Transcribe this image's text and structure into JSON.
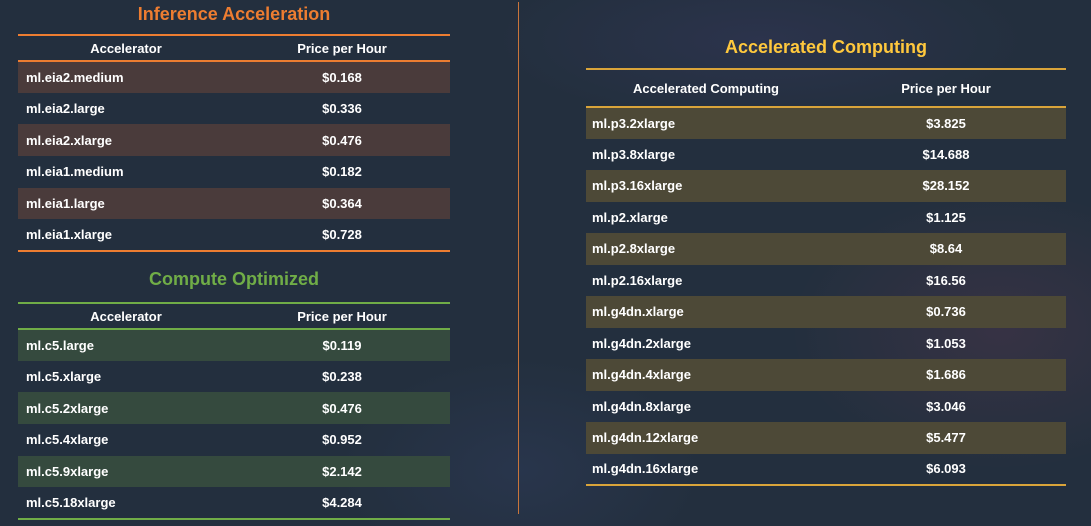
{
  "colors": {
    "background": "#232f3e",
    "inference_accent": "#ed7d31",
    "compute_accent": "#70ad47",
    "accelerated_accent": "#ffc83d"
  },
  "inference": {
    "title": "Inference Acceleration",
    "headers": [
      "Accelerator",
      "Price per Hour"
    ],
    "rows": [
      {
        "name": "ml.eia2.medium",
        "price": "$0.168"
      },
      {
        "name": "ml.eia2.large",
        "price": "$0.336"
      },
      {
        "name": "ml.eia2.xlarge",
        "price": "$0.476"
      },
      {
        "name": "ml.eia1.medium",
        "price": "$0.182"
      },
      {
        "name": "ml.eia1.large",
        "price": "$0.364"
      },
      {
        "name": "ml.eia1.xlarge",
        "price": "$0.728"
      }
    ]
  },
  "compute": {
    "title": "Compute Optimized",
    "headers": [
      "Accelerator",
      "Price per Hour"
    ],
    "rows": [
      {
        "name": "ml.c5.large",
        "price": "$0.119"
      },
      {
        "name": "ml.c5.xlarge",
        "price": "$0.238"
      },
      {
        "name": "ml.c5.2xlarge",
        "price": "$0.476"
      },
      {
        "name": "ml.c5.4xlarge",
        "price": "$0.952"
      },
      {
        "name": "ml.c5.9xlarge",
        "price": "$2.142"
      },
      {
        "name": "ml.c5.18xlarge",
        "price": "$4.284"
      }
    ]
  },
  "accelerated": {
    "title": "Accelerated Computing",
    "headers": [
      "Accelerated Computing",
      "Price per Hour"
    ],
    "rows": [
      {
        "name": "ml.p3.2xlarge",
        "price": "$3.825"
      },
      {
        "name": "ml.p3.8xlarge",
        "price": "$14.688"
      },
      {
        "name": "ml.p3.16xlarge",
        "price": "$28.152"
      },
      {
        "name": "ml.p2.xlarge",
        "price": "$1.125"
      },
      {
        "name": "ml.p2.8xlarge",
        "price": "$8.64"
      },
      {
        "name": "ml.p2.16xlarge",
        "price": "$16.56"
      },
      {
        "name": "ml.g4dn.xlarge",
        "price": "$0.736"
      },
      {
        "name": "ml.g4dn.2xlarge",
        "price": "$1.053"
      },
      {
        "name": "ml.g4dn.4xlarge",
        "price": "$1.686"
      },
      {
        "name": "ml.g4dn.8xlarge",
        "price": "$3.046"
      },
      {
        "name": "ml.g4dn.12xlarge",
        "price": "$5.477"
      },
      {
        "name": "ml.g4dn.16xlarge",
        "price": "$6.093"
      }
    ]
  }
}
